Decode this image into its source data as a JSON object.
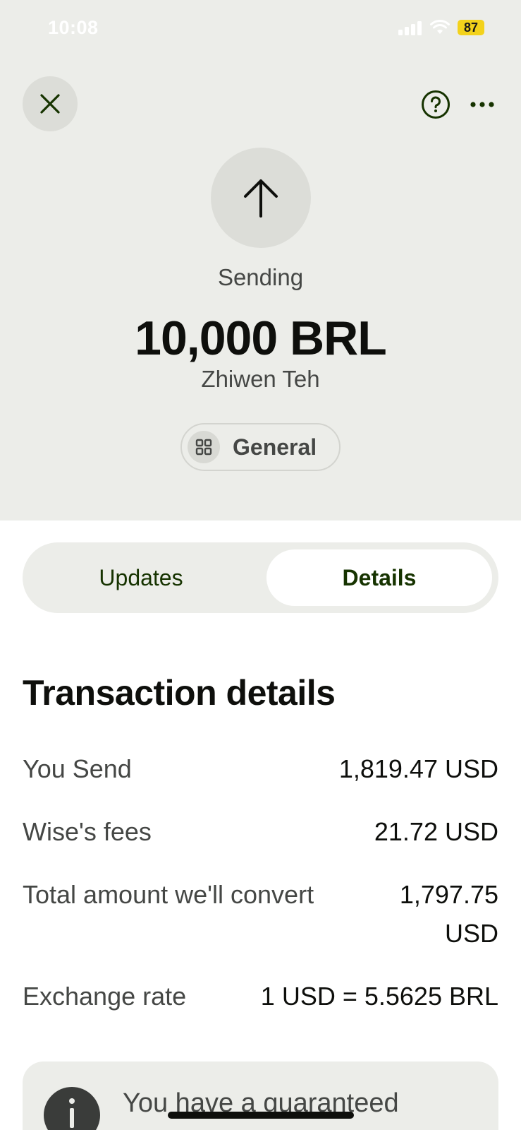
{
  "status_bar": {
    "time": "10:08",
    "battery": "87"
  },
  "header": {
    "close_icon": "close-icon",
    "help_icon": "help-icon",
    "more_icon": "more-icon",
    "status_label": "Sending",
    "amount": "10,000 BRL",
    "recipient": "Zhiwen Teh",
    "category_label": "General",
    "category_icon": "grid-icon"
  },
  "tabs": [
    {
      "label": "Updates",
      "selected": false
    },
    {
      "label": "Details",
      "selected": true
    }
  ],
  "details": {
    "title": "Transaction details",
    "rows": [
      {
        "label": "You Send",
        "value": "1,819.47 USD"
      },
      {
        "label": "Wise's fees",
        "value": "21.72 USD"
      },
      {
        "label": "Total amount we'll convert",
        "value_line1": "1,797.75",
        "value_line2": "USD"
      },
      {
        "label": "Exchange rate",
        "value": "1 USD = 5.5625 BRL"
      }
    ]
  },
  "info_card": {
    "icon": "info-icon",
    "text": "You have a guaranteed"
  },
  "colors": {
    "header_bg": "#ecede9",
    "accent_green": "#163300",
    "battery": "#f3d21b"
  }
}
